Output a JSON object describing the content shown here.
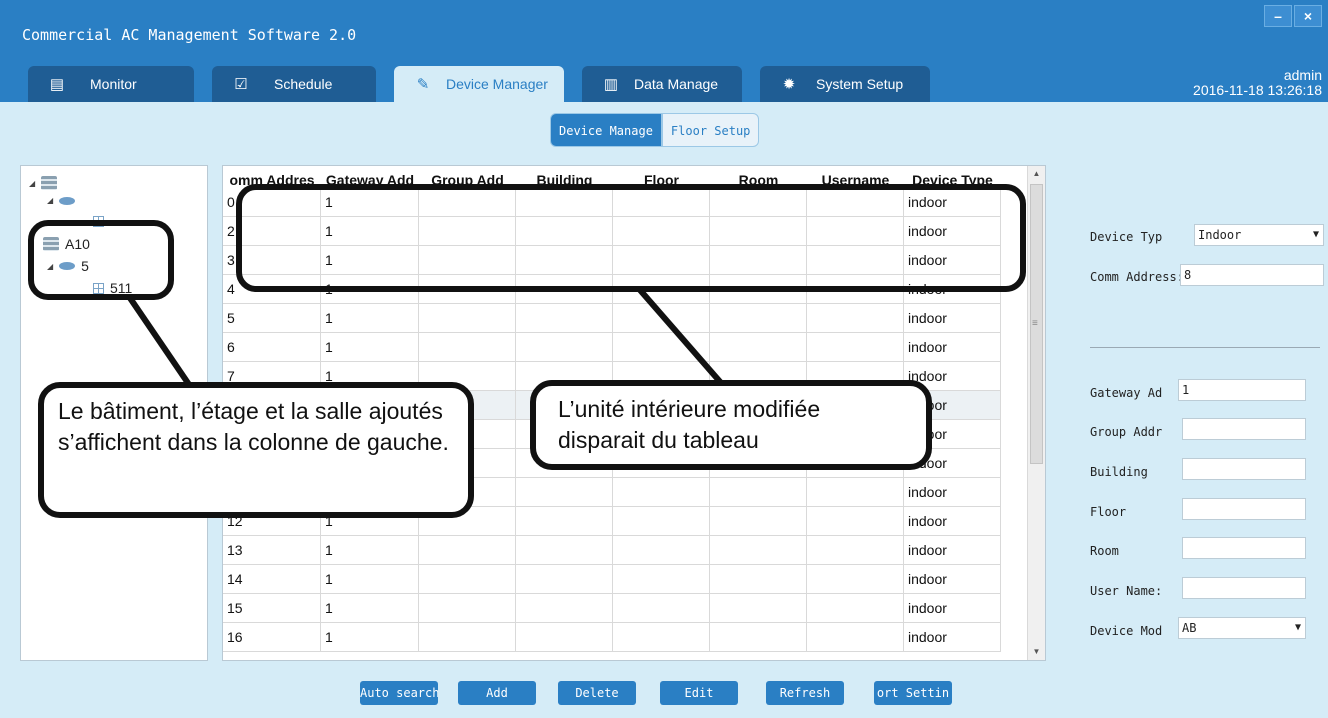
{
  "app": {
    "title": "Commercial AC Management Software 2.0",
    "minimize": "–",
    "close": "×",
    "user": "admin",
    "datetime": "2016-11-18 13:26:18"
  },
  "tabs": [
    {
      "label": "Monitor",
      "icon": "monitor-icon"
    },
    {
      "label": "Schedule",
      "icon": "calendar-icon"
    },
    {
      "label": "Device Manager",
      "icon": "wrench-icon"
    },
    {
      "label": "Data Manage",
      "icon": "bar-chart-icon"
    },
    {
      "label": "System Setup",
      "icon": "gear-icon"
    }
  ],
  "subtabs": [
    "Device Manage",
    "Floor Setup"
  ],
  "tree": {
    "building": "A10",
    "floor": "5",
    "room": "511"
  },
  "table": {
    "headers": [
      "omm Addres",
      "Gateway Add",
      "Group Add",
      "Building",
      "Floor",
      "Room",
      "Username",
      "Device Type"
    ],
    "rows": [
      [
        "0",
        "1",
        "",
        "",
        "",
        "",
        "",
        "indoor"
      ],
      [
        "2",
        "1",
        "",
        "",
        "",
        "",
        "",
        "indoor"
      ],
      [
        "3",
        "1",
        "",
        "",
        "",
        "",
        "",
        "indoor"
      ],
      [
        "4",
        "1",
        "",
        "",
        "",
        "",
        "",
        "indoor"
      ],
      [
        "5",
        "1",
        "",
        "",
        "",
        "",
        "",
        "indoor"
      ],
      [
        "6",
        "1",
        "",
        "",
        "",
        "",
        "",
        "indoor"
      ],
      [
        "7",
        "1",
        "",
        "",
        "",
        "",
        "",
        "indoor"
      ],
      [
        "",
        "",
        "",
        "",
        "",
        "",
        "",
        "indoor"
      ],
      [
        "",
        "",
        "",
        "",
        "",
        "",
        "",
        "indoor"
      ],
      [
        "",
        "",
        "",
        "",
        "",
        "",
        "",
        "indoor"
      ],
      [
        "",
        "",
        "",
        "",
        "",
        "",
        "",
        "indoor"
      ],
      [
        "12",
        "1",
        "",
        "",
        "",
        "",
        "",
        "indoor"
      ],
      [
        "13",
        "1",
        "",
        "",
        "",
        "",
        "",
        "indoor"
      ],
      [
        "14",
        "1",
        "",
        "",
        "",
        "",
        "",
        "indoor"
      ],
      [
        "15",
        "1",
        "",
        "",
        "",
        "",
        "",
        "indoor"
      ],
      [
        "16",
        "1",
        "",
        "",
        "",
        "",
        "",
        "indoor"
      ]
    ]
  },
  "form": {
    "device_type_label": "Device Typ",
    "device_type_value": "Indoor",
    "comm_address_label": "Comm Address:",
    "comm_address_value": "8",
    "gateway_label": "Gateway Ad",
    "gateway_value": "1",
    "group_label": "Group Addr",
    "group_value": "",
    "building_label": "Building",
    "building_value": "",
    "floor_label": "Floor",
    "floor_value": "",
    "room_label": "Room",
    "room_value": "",
    "username_label": "User Name:",
    "username_value": "",
    "device_mode_label": "Device Mod",
    "device_mode_value": "AB"
  },
  "buttons": {
    "auto_search": "Auto search",
    "add": "Add",
    "delete": "Delete",
    "edit": "Edit",
    "refresh": "Refresh",
    "port_setting": "ort Settin"
  },
  "callouts": {
    "left": "Le bâtiment, l’étage et la salle ajoutés s’affichent dans la colonne de gauche.",
    "right": "L’unité intérieure modifiée disparait du tableau"
  }
}
